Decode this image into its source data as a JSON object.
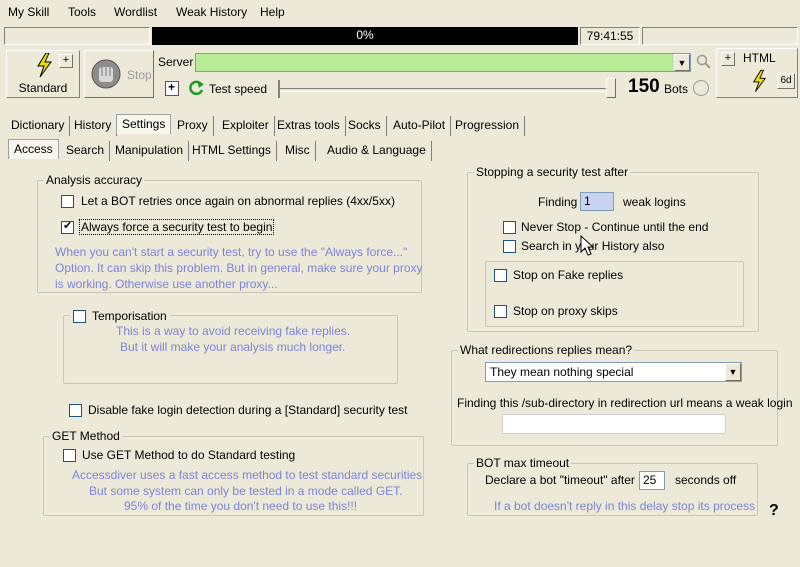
{
  "menu": [
    "My Skill",
    "Tools",
    "Wordlist",
    "Weak History",
    "Help"
  ],
  "status": {
    "progress": "0%",
    "timer": "79:41:55"
  },
  "toolbar": {
    "standard_label": "Standard",
    "plus": "+",
    "stop_label": "Stop",
    "server_label": "Server",
    "test_speed_label": "Test speed",
    "bots_count": "150",
    "bots_label": "Bots",
    "html_label": "HTML",
    "html_plus": "+",
    "html_small": "6d"
  },
  "tabs_main": [
    "Dictionary",
    "History",
    "Settings",
    "Proxy",
    "Exploiter",
    "Extras tools",
    "Socks",
    "Auto-Pilot",
    "Progression"
  ],
  "tabs_sub": [
    "Access",
    "Search",
    "Manipulation",
    "HTML Settings",
    "Misc",
    "Audio & Language"
  ],
  "analysis": {
    "title": "Analysis accuracy",
    "retry_label": "Let a BOT retries once again on abnormal replies (4xx/5xx)",
    "force_label": "Always force a security test to begin",
    "hint_1": "When you can't start a security test, try to use the \"Always force...\"",
    "hint_2": "Option. It can skip this problem. But in general, make sure your proxy",
    "hint_3": "is working. Otherwise use another proxy..."
  },
  "temporisation": {
    "label": "Temporisation",
    "hint_1": "This is a way to avoid receiving fake replies.",
    "hint_2": "But it will make your analysis much longer."
  },
  "disable_fake_label": "Disable fake login detection during a [Standard] security test",
  "get_method": {
    "title": "GET Method",
    "label": "Use GET Method to do Standard testing",
    "hint_1": "Accessdiver uses a fast access method to test standard securities",
    "hint_2": "But some system can only be tested in a mode called GET.",
    "hint_3": "95% of the time you don't need to use this!!!"
  },
  "stopping": {
    "title": "Stopping a security test after",
    "finding_label": "Finding",
    "finding_value": "1",
    "weak_logins_label": "weak logins",
    "never_stop_label": "Never Stop - Continue until the end",
    "search_history_label": "Search in your History also",
    "fake_replies_label": "Stop on Fake replies",
    "proxy_skips_label": "Stop on proxy skips"
  },
  "redirections": {
    "title": "What redirections replies mean?",
    "selected": "They mean nothing special",
    "subdir_label": "Finding this /sub-directory in redirection url means a weak login",
    "subdir_value": ""
  },
  "bot_timeout": {
    "title": "BOT max timeout",
    "declare_label": "Declare a bot \"timeout\" after",
    "value": "25",
    "seconds_label": "seconds off",
    "hint": "If a bot doesn't reply in this delay stop its process"
  },
  "help_mark": "?",
  "colors": {
    "server_field": "#b7eb96",
    "hint_text": "#7c84d6",
    "bolt": "#f2dd00"
  }
}
